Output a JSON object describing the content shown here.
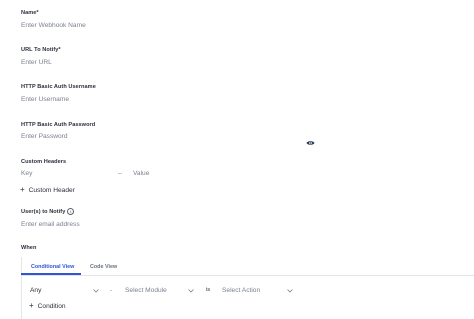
{
  "fields": {
    "name": {
      "label": "Name*",
      "placeholder": "Enter Webhook Name"
    },
    "url": {
      "label": "URL To Notify*",
      "placeholder": "Enter URL"
    },
    "auth_user": {
      "label": "HTTP Basic Auth Username",
      "placeholder": "Enter Username"
    },
    "auth_pass": {
      "label": "HTTP Basic Auth Password",
      "placeholder": "Enter Password"
    }
  },
  "headers": {
    "label": "Custom Headers",
    "key_placeholder": "Key",
    "separator": "–",
    "value_placeholder": "Value",
    "add_label": "Custom Header"
  },
  "users": {
    "label": "User(s) to Notify",
    "placeholder": "Enter email address"
  },
  "when": {
    "label": "When",
    "tabs": [
      {
        "label": "Conditional View",
        "active": true
      },
      {
        "label": "Code View",
        "active": false
      }
    ],
    "condition": {
      "any_label": "Any",
      "dash": "-",
      "module_placeholder": "Select Module",
      "is_label": "is",
      "action_placeholder": "Select Action"
    },
    "add_condition_label": "Condition"
  },
  "colors": {
    "accent": "#2f55d4",
    "border": "#e3e5ea",
    "muted_text": "#7b8190"
  },
  "icons": {
    "password_toggle": "eye-icon",
    "info": "info-icon",
    "add": "plus-icon",
    "dropdown": "chevron-down-icon"
  }
}
